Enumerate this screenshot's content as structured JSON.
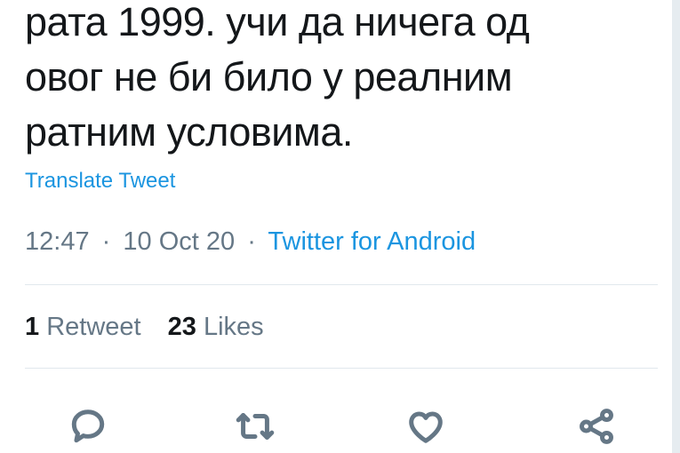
{
  "tweet": {
    "text_lines": [
      "рата 1999. учи да ничега од",
      "овог не би било у реалним",
      "ратним условима."
    ],
    "translate_label": "Translate Tweet",
    "time": "12:47",
    "separator": "·",
    "date": "10 Oct 20",
    "source": "Twitter for Android"
  },
  "stats": {
    "retweets_count": "1",
    "retweets_label": "Retweet",
    "likes_count": "23",
    "likes_label": "Likes"
  },
  "actions": [
    {
      "icon": "reply-icon"
    },
    {
      "icon": "retweet-icon"
    },
    {
      "icon": "like-icon"
    },
    {
      "icon": "share-icon"
    }
  ],
  "colors": {
    "text": "#14171a",
    "secondary": "#657786",
    "link": "#1b95e0",
    "divider": "#e1e8ed"
  }
}
